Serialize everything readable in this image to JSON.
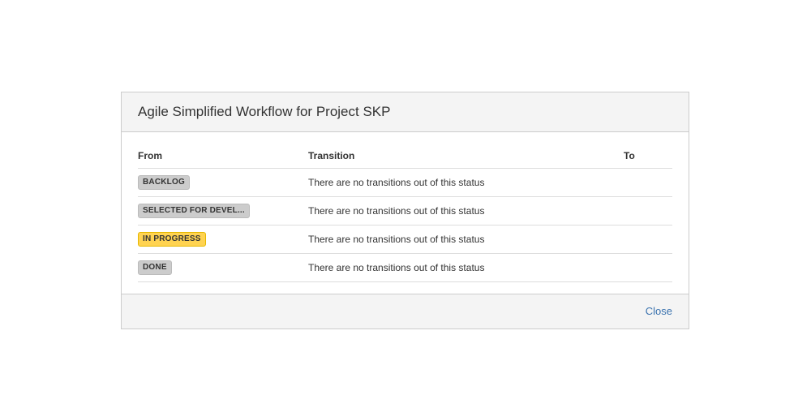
{
  "dialog": {
    "title": "Agile Simplified Workflow for Project SKP",
    "close_label": "Close"
  },
  "table": {
    "headers": {
      "from": "From",
      "transition": "Transition",
      "to": "To"
    },
    "rows": [
      {
        "status_label": "BACKLOG",
        "status_type": "default",
        "transition_text": "There are no transitions out of this status",
        "to": ""
      },
      {
        "status_label": "SELECTED FOR DEVEL...",
        "status_type": "default",
        "transition_text": "There are no transitions out of this status",
        "to": ""
      },
      {
        "status_label": "IN PROGRESS",
        "status_type": "in-progress",
        "transition_text": "There are no transitions out of this status",
        "to": ""
      },
      {
        "status_label": "DONE",
        "status_type": "default",
        "transition_text": "There are no transitions out of this status",
        "to": ""
      }
    ]
  }
}
